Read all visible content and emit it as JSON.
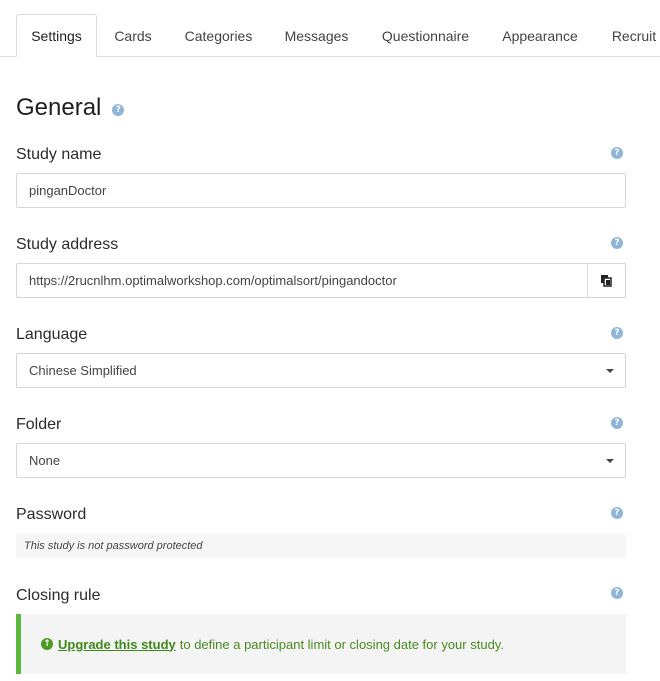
{
  "tabs": [
    {
      "label": "Settings",
      "active": true
    },
    {
      "label": "Cards"
    },
    {
      "label": "Categories"
    },
    {
      "label": "Messages"
    },
    {
      "label": "Questionnaire"
    },
    {
      "label": "Appearance"
    },
    {
      "label": "Recruit"
    }
  ],
  "general": {
    "heading": "General",
    "help_icon": "?"
  },
  "study_name": {
    "label": "Study name",
    "value": "pinganDoctor"
  },
  "study_address": {
    "label": "Study address",
    "value": "https://2rucnlhm.optimalworkshop.com/optimalsort/pingandoctor",
    "copy_icon": "copy-icon"
  },
  "language": {
    "label": "Language",
    "selected": "Chinese Simplified"
  },
  "folder": {
    "label": "Folder",
    "selected": "None"
  },
  "password": {
    "label": "Password",
    "note": "This study is not password protected"
  },
  "closing_rule": {
    "label": "Closing rule",
    "upgrade_link": "Upgrade this study",
    "upgrade_text": "to define a participant limit or closing date for your study.",
    "accent_color": "#5cb83c"
  }
}
